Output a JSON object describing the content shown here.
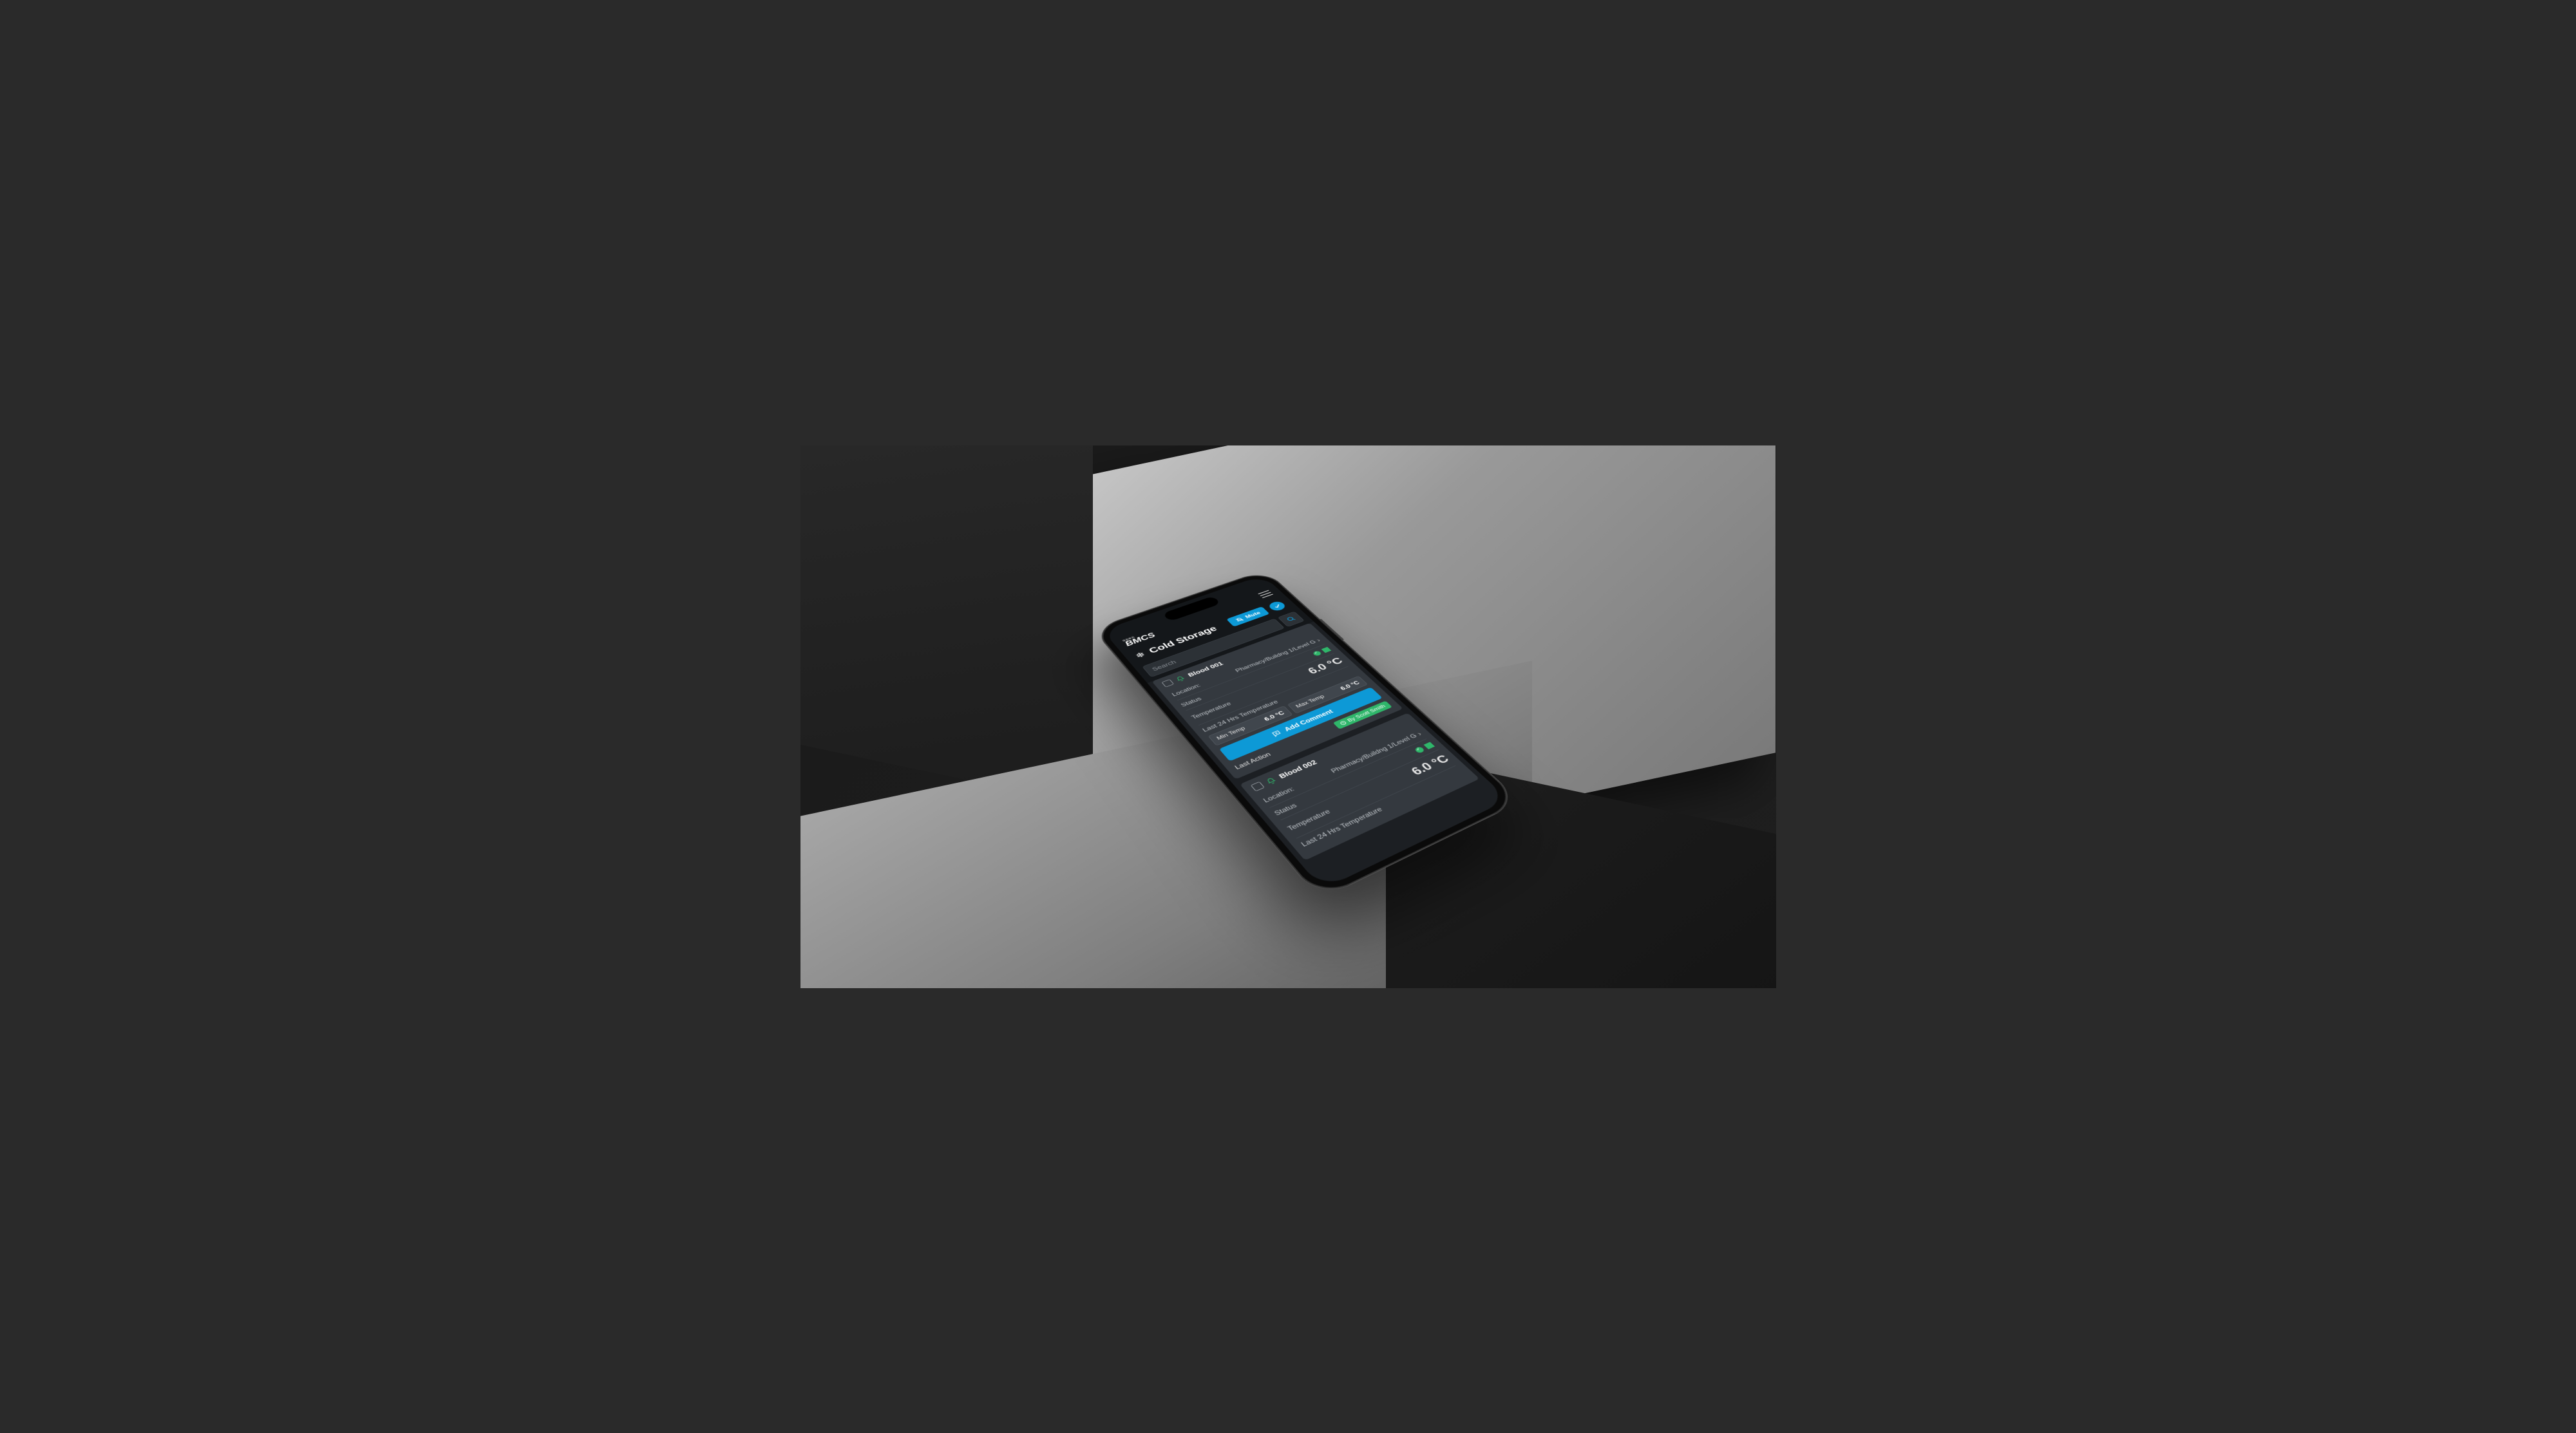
{
  "logo": {
    "super": "open",
    "main": "BMCS"
  },
  "title": "Cold Storage",
  "mute_label": "Mute",
  "search": {
    "placeholder": "Search"
  },
  "add_comment_label": "Add Comment",
  "labels": {
    "location": "Location:",
    "status": "Status",
    "temperature": "Temperature",
    "last24": "Last 24 Hrs Temperature",
    "min": "Min Temp",
    "max": "Max Temp",
    "last_action": "Last Action"
  },
  "cards": [
    {
      "name": "Blood 001",
      "location": "Pharmacy/Buildng 1/Level G",
      "temperature": "6.0 °C",
      "min": "6.0 °C",
      "max": "6.0 °C",
      "last_action_by": "By Scott Smith"
    },
    {
      "name": "Blood 002",
      "location": "Pharmacy/Buildng 1/Level G",
      "temperature": "6.0 °C"
    }
  ]
}
